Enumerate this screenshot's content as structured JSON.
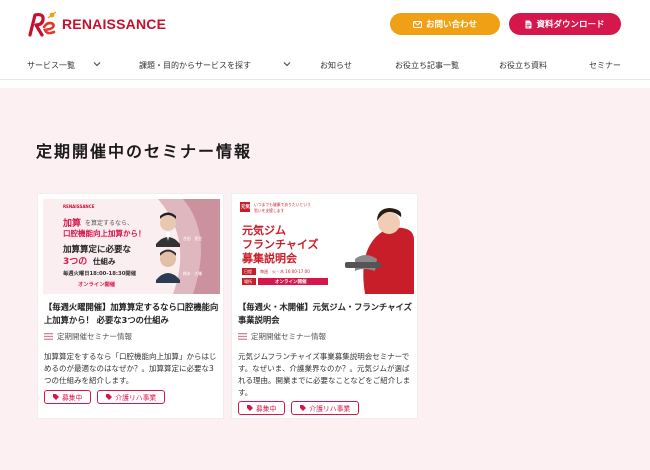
{
  "header": {
    "brand": "RENAISSANCE",
    "contact_label": "お問い合わせ",
    "download_label": "資料ダウンロード"
  },
  "nav": {
    "items": [
      {
        "label": "サービス一覧"
      },
      {
        "label": "課題・目的からサービスを探す"
      },
      {
        "label": "お知らせ"
      },
      {
        "label": "お役立ち記事一覧"
      },
      {
        "label": "お役立ち資料"
      },
      {
        "label": "セミナー"
      }
    ]
  },
  "main": {
    "title": "定期開催中のセミナー情報"
  },
  "cards": [
    {
      "image": {
        "brand": "RENAISSANCE",
        "line1": "加算",
        "line1b": "を算定するなら、",
        "line2": "口腔機能向上加算から！",
        "line3": "加算算定に必要な",
        "line4a": "3つの",
        "line4b": "仕組み",
        "schedule": "毎週火曜日18:00-18:30開催",
        "online": "オンライン開催",
        "speaker1_name": "合田　恵里",
        "speaker2_name": "橋本　大輔"
      },
      "title": "【毎週火曜開催】加算算定するなら口腔機能向上加算から！ 必要な3つの仕組み",
      "category": "定期開催セミナー情報",
      "description": "加算算定をするなら「口腔機能向上加算」からはじめるのが最適なのはなぜか？。加算算定に必要な3つの仕組みを紹介します。",
      "tags": [
        "募集中",
        "介護リハ事業"
      ]
    },
    {
      "image": {
        "badge": "元気",
        "tagline1": "いつまでも健康でありたいという",
        "tagline2": "思いを支援します",
        "line1": "元気ジム",
        "line2": "フランチャイズ",
        "line3": "募集説明会",
        "row1_label": "日程",
        "row1_value": "毎週　火・木 16:00-17:00",
        "row2_label": "場所",
        "row2_value": "オンライン開催"
      },
      "title": "【毎週火・木開催】元気ジム・フランチャイズ事業説明会",
      "category": "定期開催セミナー情報",
      "description": "元気ジムフランチャイズ事業募集説明会セミナーです。なぜいま、介護業界なのか？。元気ジムが選ばれる理由。開業までに必要なことなどをご紹介します。",
      "tags": [
        "募集中",
        "介護リハ事業"
      ]
    }
  ],
  "colors": {
    "brand_red": "#c8102e",
    "accent_pink": "#d6174c",
    "contact_orange": "#f0a014",
    "main_bg": "#fdf0f3"
  }
}
